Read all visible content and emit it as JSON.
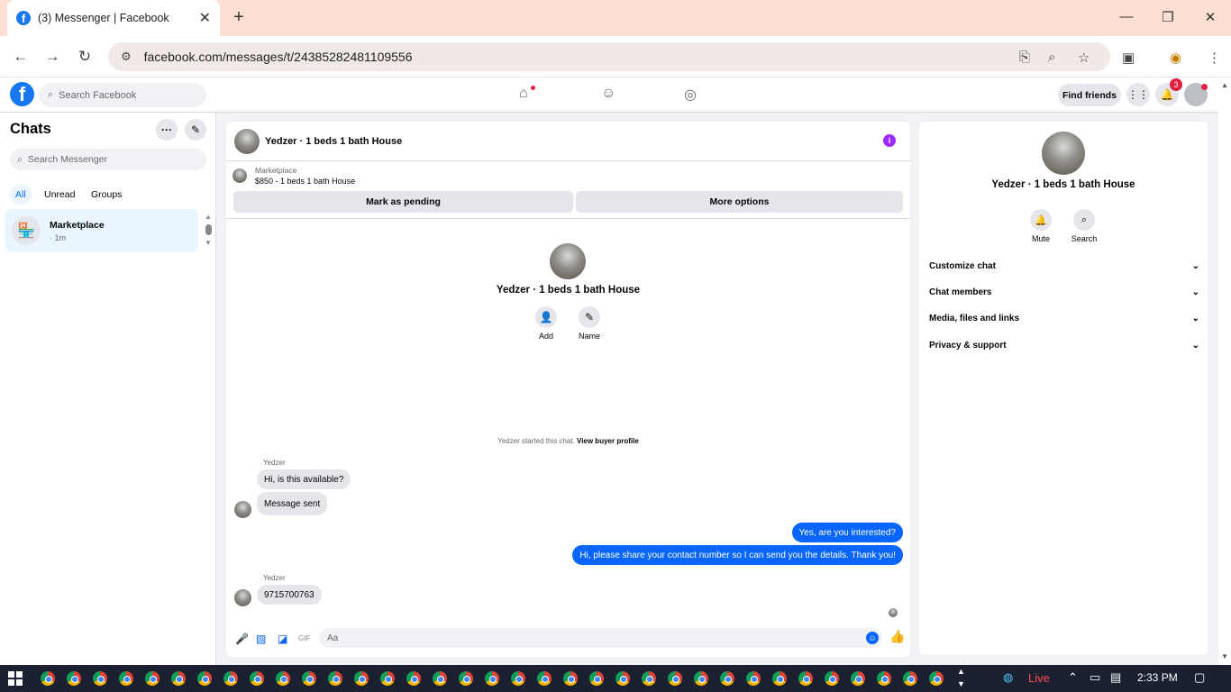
{
  "browser": {
    "tab_title": "(3) Messenger | Facebook",
    "url": "facebook.com/messages/t/24385282481109556"
  },
  "fb": {
    "search_placeholder": "Search Facebook",
    "find_friends": "Find friends",
    "notif_count": "3"
  },
  "chats": {
    "heading": "Chats",
    "search_placeholder": "Search Messenger",
    "filters": [
      "All",
      "Unread",
      "Groups"
    ],
    "item": {
      "name": "Marketplace",
      "time": "· 1m"
    }
  },
  "conversation": {
    "title": "Yedzer · 1 beds 1 bath House",
    "marketplace_label": "Marketplace",
    "listing": "$850 - 1 beds 1 bath House",
    "mark_pending": "Mark as pending",
    "more_options": "More options",
    "add_label": "Add",
    "name_label": "Name",
    "started_text": "Yedzer started this chat.",
    "buyer_profile": "View buyer profile",
    "messages": [
      {
        "sender": "Yedzer",
        "text": "Hi, is this available?"
      },
      {
        "text": "Message sent"
      },
      {
        "text": "Yes, are you interested?"
      },
      {
        "text": "Hi, please share your contact number so I can send you the details. Thank you!"
      },
      {
        "sender": "Yedzer",
        "text": "9715700763"
      }
    ],
    "composer_placeholder": "Aa"
  },
  "details": {
    "name": "Yedzer · 1 beds 1 bath House",
    "mute": "Mute",
    "search": "Search",
    "sections": [
      "Customize chat",
      "Chat members",
      "Media, files and links",
      "Privacy & support"
    ]
  },
  "taskbar": {
    "live": "Live",
    "time": "2:33 PM"
  }
}
